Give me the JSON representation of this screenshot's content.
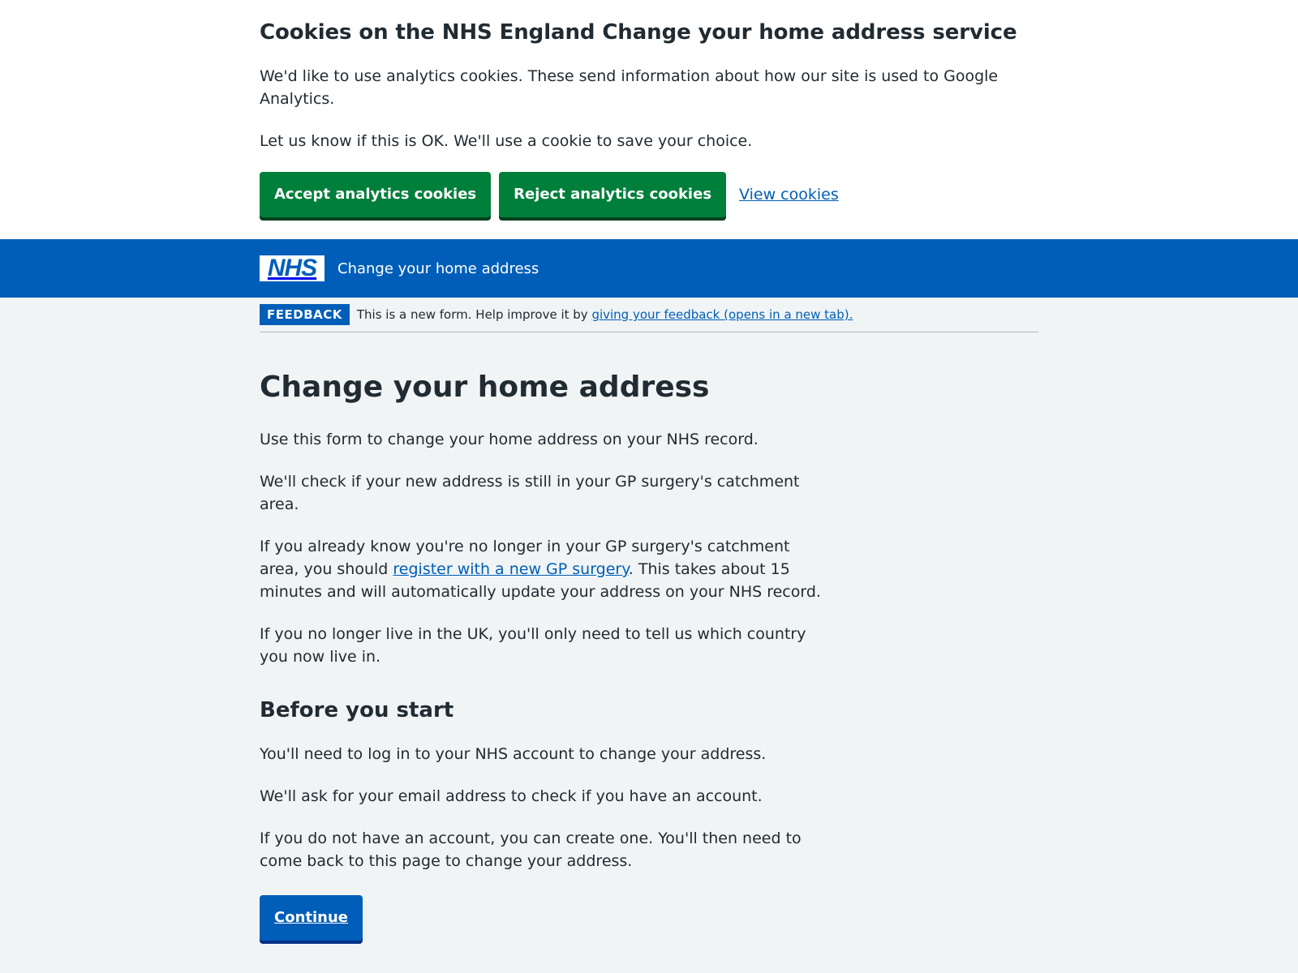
{
  "cookie_banner": {
    "title": "Cookies on the NHS England Change your home address service",
    "p1": "We'd like to use analytics cookies. These send information about how our site is used to Google Analytics.",
    "p2": "Let us know if this is OK. We'll use a cookie to save your choice.",
    "accept_label": "Accept analytics cookies",
    "reject_label": "Reject analytics cookies",
    "view_label": "View cookies"
  },
  "header": {
    "logo_text": "NHS",
    "service_name": "Change your home address"
  },
  "feedback": {
    "tag": "FEEDBACK",
    "text": "This is a new form. Help improve it by ",
    "link": "giving your feedback (opens in a new tab)."
  },
  "main": {
    "title": "Change your home address",
    "p1": "Use this form to change your home address on your NHS record.",
    "p2": "We'll check if your new address is still in your GP surgery's catchment area.",
    "p3_before": "If you already know you're no longer in your GP surgery's catchment area, you should ",
    "p3_link": "register with a new GP surgery",
    "p3_after": ". This takes about 15 minutes and will automatically update your address on your NHS record.",
    "p4": "If you no longer live in the UK, you'll only need to tell us which country you now live in.",
    "subheading": "Before you start",
    "p5": "You'll need to log in to your NHS account to change your address.",
    "p6": "We'll ask for your email address to check if you have an account.",
    "p7": "If you do not have an account, you can create one. You'll then need to come back to this page to change your address.",
    "continue_label": "Continue"
  },
  "colors": {
    "nhs_blue": "#005eb8",
    "nhs_green": "#007f3b",
    "page_bg": "#f0f4f5",
    "text": "#212b32"
  }
}
